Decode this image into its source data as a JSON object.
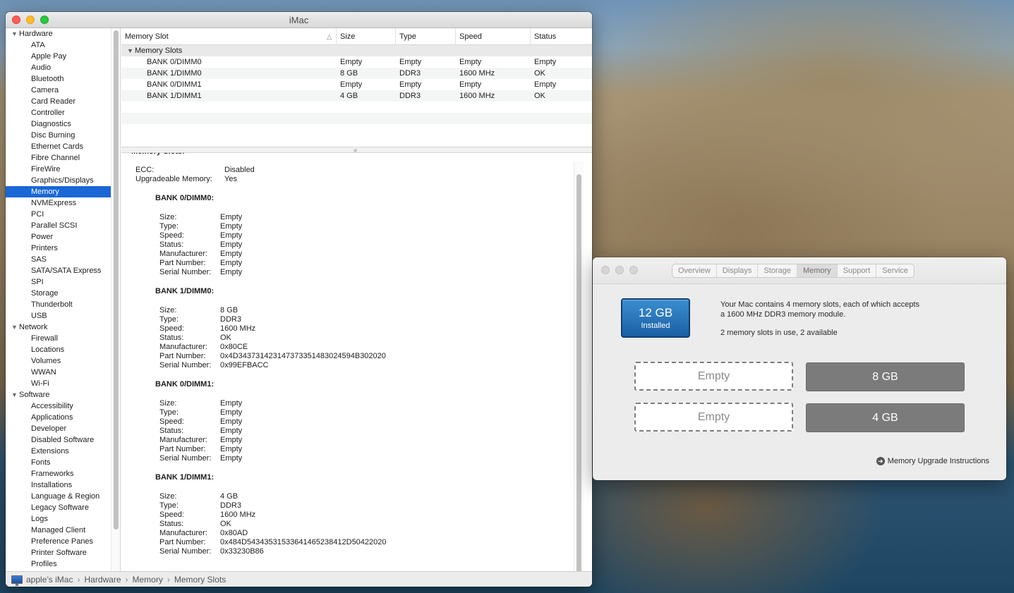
{
  "si_window": {
    "title": "iMac",
    "sidebar": [
      {
        "type": "group",
        "label": "Hardware"
      },
      {
        "type": "item",
        "label": "ATA"
      },
      {
        "type": "item",
        "label": "Apple Pay"
      },
      {
        "type": "item",
        "label": "Audio"
      },
      {
        "type": "item",
        "label": "Bluetooth"
      },
      {
        "type": "item",
        "label": "Camera"
      },
      {
        "type": "item",
        "label": "Card Reader"
      },
      {
        "type": "item",
        "label": "Controller"
      },
      {
        "type": "item",
        "label": "Diagnostics"
      },
      {
        "type": "item",
        "label": "Disc Burning"
      },
      {
        "type": "item",
        "label": "Ethernet Cards"
      },
      {
        "type": "item",
        "label": "Fibre Channel"
      },
      {
        "type": "item",
        "label": "FireWire"
      },
      {
        "type": "item",
        "label": "Graphics/Displays"
      },
      {
        "type": "item",
        "label": "Memory",
        "selected": true
      },
      {
        "type": "item",
        "label": "NVMExpress"
      },
      {
        "type": "item",
        "label": "PCI"
      },
      {
        "type": "item",
        "label": "Parallel SCSI"
      },
      {
        "type": "item",
        "label": "Power"
      },
      {
        "type": "item",
        "label": "Printers"
      },
      {
        "type": "item",
        "label": "SAS"
      },
      {
        "type": "item",
        "label": "SATA/SATA Express"
      },
      {
        "type": "item",
        "label": "SPI"
      },
      {
        "type": "item",
        "label": "Storage"
      },
      {
        "type": "item",
        "label": "Thunderbolt"
      },
      {
        "type": "item",
        "label": "USB"
      },
      {
        "type": "group",
        "label": "Network"
      },
      {
        "type": "item",
        "label": "Firewall"
      },
      {
        "type": "item",
        "label": "Locations"
      },
      {
        "type": "item",
        "label": "Volumes"
      },
      {
        "type": "item",
        "label": "WWAN"
      },
      {
        "type": "item",
        "label": "Wi-Fi"
      },
      {
        "type": "group",
        "label": "Software"
      },
      {
        "type": "item",
        "label": "Accessibility"
      },
      {
        "type": "item",
        "label": "Applications"
      },
      {
        "type": "item",
        "label": "Developer"
      },
      {
        "type": "item",
        "label": "Disabled Software"
      },
      {
        "type": "item",
        "label": "Extensions"
      },
      {
        "type": "item",
        "label": "Fonts"
      },
      {
        "type": "item",
        "label": "Frameworks"
      },
      {
        "type": "item",
        "label": "Installations"
      },
      {
        "type": "item",
        "label": "Language & Region"
      },
      {
        "type": "item",
        "label": "Legacy Software"
      },
      {
        "type": "item",
        "label": "Logs"
      },
      {
        "type": "item",
        "label": "Managed Client"
      },
      {
        "type": "item",
        "label": "Preference Panes"
      },
      {
        "type": "item",
        "label": "Printer Software"
      },
      {
        "type": "item",
        "label": "Profiles"
      }
    ],
    "table": {
      "columns": [
        "Memory Slot",
        "Size",
        "Type",
        "Speed",
        "Status"
      ],
      "sort_indicator": "^",
      "group_label": "Memory Slots",
      "rows": [
        [
          "BANK 0/DIMM0",
          "Empty",
          "Empty",
          "Empty",
          "Empty"
        ],
        [
          "BANK 1/DIMM0",
          "8 GB",
          "DDR3",
          "1600 MHz",
          "OK"
        ],
        [
          "BANK 0/DIMM1",
          "Empty",
          "Empty",
          "Empty",
          "Empty"
        ],
        [
          "BANK 1/DIMM1",
          "4 GB",
          "DDR3",
          "1600 MHz",
          "OK"
        ]
      ]
    },
    "detail": {
      "section_title": "Memory Slots:",
      "ecc_label": "ECC:",
      "ecc_value": "Disabled",
      "upgradeable_label": "Upgradeable Memory:",
      "upgradeable_value": "Yes",
      "field_labels": [
        "Size:",
        "Type:",
        "Speed:",
        "Status:",
        "Manufacturer:",
        "Part Number:",
        "Serial Number:"
      ],
      "banks": [
        {
          "title": "BANK 0/DIMM0:",
          "values": [
            "Empty",
            "Empty",
            "Empty",
            "Empty",
            "Empty",
            "Empty",
            "Empty"
          ]
        },
        {
          "title": "BANK 1/DIMM0:",
          "values": [
            "8 GB",
            "DDR3",
            "1600 MHz",
            "OK",
            "0x80CE",
            "0x4D343731423147373351483024594B302020",
            "0x99EFBACC"
          ]
        },
        {
          "title": "BANK 0/DIMM1:",
          "values": [
            "Empty",
            "Empty",
            "Empty",
            "Empty",
            "Empty",
            "Empty",
            "Empty"
          ]
        },
        {
          "title": "BANK 1/DIMM1:",
          "values": [
            "4 GB",
            "DDR3",
            "1600 MHz",
            "OK",
            "0x80AD",
            "0x484D54343531533641465238412D50422020",
            "0x33230B86"
          ]
        }
      ]
    },
    "breadcrumb": [
      "apple’s iMac",
      "Hardware",
      "Memory",
      "Memory Slots"
    ],
    "breadcrumb_sep": "›"
  },
  "about_window": {
    "tabs": [
      {
        "label": "Overview",
        "active": false
      },
      {
        "label": "Displays",
        "active": false
      },
      {
        "label": "Storage",
        "active": false
      },
      {
        "label": "Memory",
        "active": true
      },
      {
        "label": "Support",
        "active": false
      },
      {
        "label": "Service",
        "active": false
      }
    ],
    "installed_amount": "12 GB",
    "installed_label": "Installed",
    "info_line1": "Your Mac contains 4 memory slots, each of which accepts",
    "info_line2": "a 1600 MHz DDR3 memory module.",
    "info_line3": "2 memory slots in use, 2 available",
    "slots": [
      "Empty",
      "8 GB",
      "Empty",
      "4 GB"
    ],
    "upgrade_link": "Memory Upgrade Instructions"
  },
  "colors": {
    "selection": "#1a67d6",
    "badge": "#1b5fa3",
    "filled_slot": "#7b7b7b"
  }
}
